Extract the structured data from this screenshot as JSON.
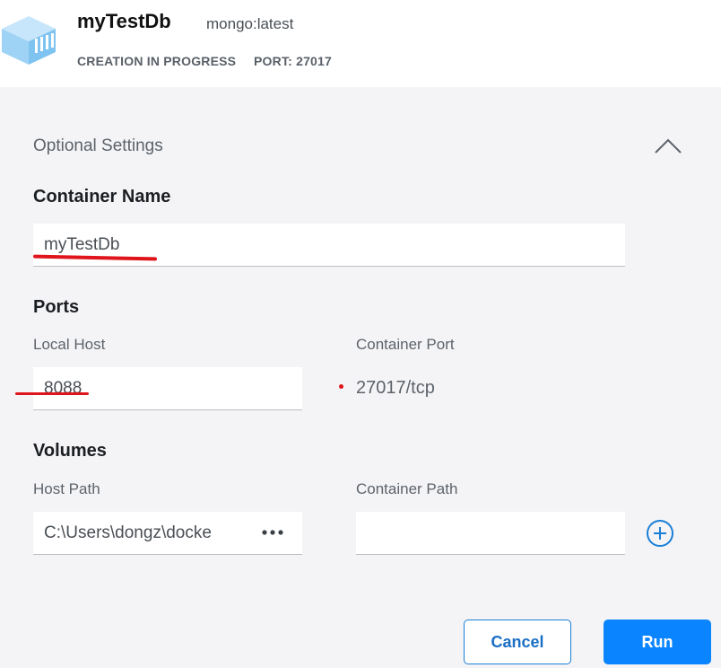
{
  "header": {
    "container_name": "myTestDb",
    "image": "mongo:latest",
    "status": "CREATION IN PROGRESS",
    "port": "PORT: 27017",
    "icon": "docker-container-icon"
  },
  "optional_settings": {
    "title": "Optional Settings",
    "collapse_icon": "chevron-up-icon"
  },
  "container_name_section": {
    "title": "Container Name",
    "value": "myTestDb"
  },
  "ports": {
    "title": "Ports",
    "local_host_label": "Local Host",
    "container_port_label": "Container Port",
    "local_host_value": "8088",
    "container_port_value": "27017/tcp"
  },
  "volumes": {
    "title": "Volumes",
    "host_path_label": "Host Path",
    "container_path_label": "Container Path",
    "host_path_value": "C:\\Users\\dongz\\docke",
    "container_path_value": "",
    "browse_icon": "ellipsis-icon",
    "add_icon": "plus-circle-icon"
  },
  "actions": {
    "cancel_label": "Cancel",
    "run_label": "Run"
  },
  "colors": {
    "accent": "#0a84ff",
    "annotation": "#e0141b",
    "icon_blue": "#7fc4f0"
  }
}
